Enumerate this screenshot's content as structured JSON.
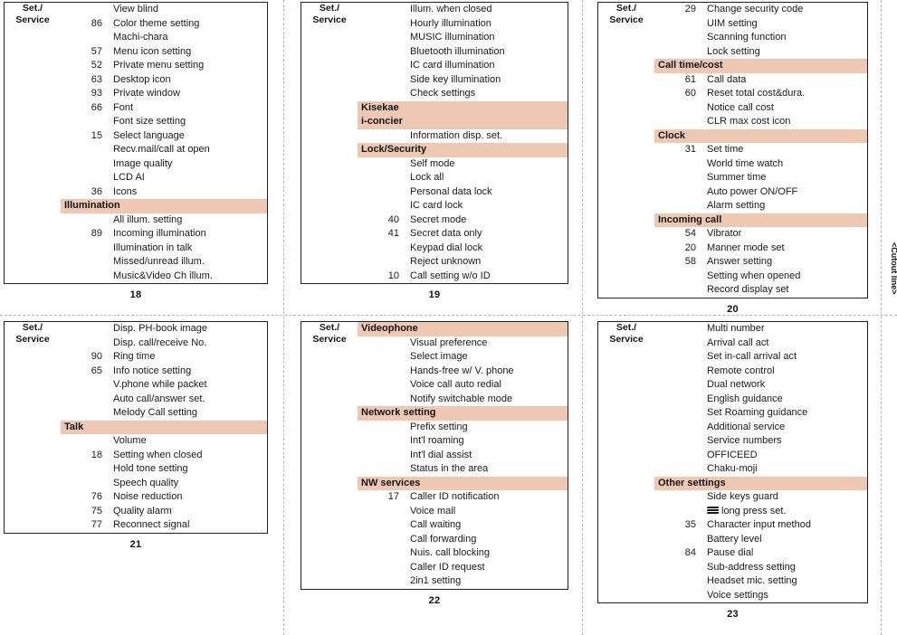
{
  "document": {
    "cutout_label": "<Cutout line>",
    "category_label_line1": "Set./",
    "category_label_line2": "Service",
    "accent_color": "#efc8b4",
    "border_color": "#231f20"
  },
  "pages": [
    {
      "number": "18",
      "category": "Set./Service",
      "rows": [
        {
          "type": "item",
          "num": "",
          "label": "View blind"
        },
        {
          "type": "item",
          "num": "86",
          "label": "Color theme setting"
        },
        {
          "type": "item",
          "num": "",
          "label": "Machi-chara"
        },
        {
          "type": "item",
          "num": "57",
          "label": "Menu icon setting"
        },
        {
          "type": "item",
          "num": "52",
          "label": "Private menu setting"
        },
        {
          "type": "item",
          "num": "63",
          "label": "Desktop icon"
        },
        {
          "type": "item",
          "num": "93",
          "label": "Private window"
        },
        {
          "type": "item",
          "num": "66",
          "label": "Font"
        },
        {
          "type": "item",
          "num": "",
          "label": "Font size setting"
        },
        {
          "type": "item",
          "num": "15",
          "label": "Select language"
        },
        {
          "type": "item",
          "num": "",
          "label": "Recv.mail/call at open"
        },
        {
          "type": "item",
          "num": "",
          "label": "Image quality"
        },
        {
          "type": "item",
          "num": "",
          "label": "LCD AI"
        },
        {
          "type": "item",
          "num": "36",
          "label": "Icons"
        },
        {
          "type": "section",
          "label": "Illumination"
        },
        {
          "type": "item",
          "num": "",
          "label": "All illum. setting"
        },
        {
          "type": "item",
          "num": "89",
          "label": "Incoming illumination"
        },
        {
          "type": "item",
          "num": "",
          "label": "Illumination in talk"
        },
        {
          "type": "item",
          "num": "",
          "label": "Missed/unread illum."
        },
        {
          "type": "item",
          "num": "",
          "label": "Music&Video Ch illum."
        }
      ]
    },
    {
      "number": "19",
      "category": "Set./Service",
      "rows": [
        {
          "type": "item",
          "num": "",
          "label": "Illum. when closed"
        },
        {
          "type": "item",
          "num": "",
          "label": "Hourly illumination"
        },
        {
          "type": "item",
          "num": "",
          "label": "MUSIC illumination"
        },
        {
          "type": "item",
          "num": "",
          "label": "Bluetooth illumination"
        },
        {
          "type": "item",
          "num": "",
          "label": "IC card illumination"
        },
        {
          "type": "item",
          "num": "",
          "label": "Side key illumination"
        },
        {
          "type": "item",
          "num": "",
          "label": "Check settings"
        },
        {
          "type": "section",
          "label": "Kisekae"
        },
        {
          "type": "section",
          "label": "i-concier"
        },
        {
          "type": "item",
          "num": "",
          "label": "Information disp. set."
        },
        {
          "type": "section",
          "label": "Lock/Security"
        },
        {
          "type": "item",
          "num": "",
          "label": "Self mode"
        },
        {
          "type": "item",
          "num": "",
          "label": "Lock all"
        },
        {
          "type": "item",
          "num": "",
          "label": "Personal data lock"
        },
        {
          "type": "item",
          "num": "",
          "label": "IC card lock"
        },
        {
          "type": "item",
          "num": "40",
          "label": "Secret mode"
        },
        {
          "type": "item",
          "num": "41",
          "label": "Secret data only"
        },
        {
          "type": "item",
          "num": "",
          "label": "Keypad dial lock"
        },
        {
          "type": "item",
          "num": "",
          "label": "Reject unknown"
        },
        {
          "type": "item",
          "num": "10",
          "label": "Call setting w/o ID"
        }
      ]
    },
    {
      "number": "20",
      "category": "Set./Service",
      "rows": [
        {
          "type": "item",
          "num": "29",
          "label": "Change security code"
        },
        {
          "type": "item",
          "num": "",
          "label": "UIM setting"
        },
        {
          "type": "item",
          "num": "",
          "label": "Scanning function"
        },
        {
          "type": "item",
          "num": "",
          "label": "Lock setting"
        },
        {
          "type": "section",
          "label": "Call time/cost"
        },
        {
          "type": "item",
          "num": "61",
          "label": "Call data"
        },
        {
          "type": "item",
          "num": "60",
          "label": "Reset total cost&dura."
        },
        {
          "type": "item",
          "num": "",
          "label": "Notice call cost"
        },
        {
          "type": "item",
          "num": "",
          "label": "CLR max cost icon"
        },
        {
          "type": "section",
          "label": "Clock"
        },
        {
          "type": "item",
          "num": "31",
          "label": "Set time"
        },
        {
          "type": "item",
          "num": "",
          "label": "World time watch"
        },
        {
          "type": "item",
          "num": "",
          "label": "Summer time"
        },
        {
          "type": "item",
          "num": "",
          "label": "Auto power ON/OFF"
        },
        {
          "type": "item",
          "num": "",
          "label": "Alarm setting"
        },
        {
          "type": "section",
          "label": "Incoming call"
        },
        {
          "type": "item",
          "num": "54",
          "label": "Vibrator"
        },
        {
          "type": "item",
          "num": "20",
          "label": "Manner mode set"
        },
        {
          "type": "item",
          "num": "58",
          "label": "Answer setting"
        },
        {
          "type": "item",
          "num": "",
          "label": "Setting when opened"
        },
        {
          "type": "item",
          "num": "",
          "label": "Record display set"
        }
      ]
    },
    {
      "number": "21",
      "category": "Set./Service",
      "rows": [
        {
          "type": "item",
          "num": "",
          "label": "Disp. PH-book image"
        },
        {
          "type": "item",
          "num": "",
          "label": "Disp. call/receive No."
        },
        {
          "type": "item",
          "num": "90",
          "label": "Ring time"
        },
        {
          "type": "item",
          "num": "65",
          "label": "Info notice setting"
        },
        {
          "type": "item",
          "num": "",
          "label": "V.phone while packet"
        },
        {
          "type": "item",
          "num": "",
          "label": "Auto call/answer set."
        },
        {
          "type": "item",
          "num": "",
          "label": "Melody Call setting"
        },
        {
          "type": "section",
          "label": "Talk"
        },
        {
          "type": "item",
          "num": "",
          "label": "Volume"
        },
        {
          "type": "item",
          "num": "18",
          "label": "Setting when closed"
        },
        {
          "type": "item",
          "num": "",
          "label": "Hold tone setting"
        },
        {
          "type": "item",
          "num": "",
          "label": "Speech quality"
        },
        {
          "type": "item",
          "num": "76",
          "label": "Noise reduction"
        },
        {
          "type": "item",
          "num": "75",
          "label": "Quality alarm"
        },
        {
          "type": "item",
          "num": "77",
          "label": "Reconnect signal"
        }
      ]
    },
    {
      "number": "22",
      "category": "Set./Service",
      "rows": [
        {
          "type": "section",
          "label": "Videophone"
        },
        {
          "type": "item",
          "num": "",
          "label": "Visual preference"
        },
        {
          "type": "item",
          "num": "",
          "label": "Select image"
        },
        {
          "type": "item",
          "num": "",
          "label": "Hands-free w/ V. phone"
        },
        {
          "type": "item",
          "num": "",
          "label": "Voice call auto redial"
        },
        {
          "type": "item",
          "num": "",
          "label": "Notify switchable mode"
        },
        {
          "type": "section",
          "label": "Network setting"
        },
        {
          "type": "item",
          "num": "",
          "label": "Prefix setting"
        },
        {
          "type": "item",
          "num": "",
          "label": "Int'l roaming"
        },
        {
          "type": "item",
          "num": "",
          "label": "Int'l dial assist"
        },
        {
          "type": "item",
          "num": "",
          "label": "Status in the area"
        },
        {
          "type": "section",
          "label": "NW services"
        },
        {
          "type": "item",
          "num": "17",
          "label": "Caller ID notification"
        },
        {
          "type": "item",
          "num": "",
          "label": "Voice mail"
        },
        {
          "type": "item",
          "num": "",
          "label": "Call waiting"
        },
        {
          "type": "item",
          "num": "",
          "label": "Call forwarding"
        },
        {
          "type": "item",
          "num": "",
          "label": "Nuis. call blocking"
        },
        {
          "type": "item",
          "num": "",
          "label": "Caller ID request"
        },
        {
          "type": "item",
          "num": "",
          "label": "2in1 setting"
        }
      ]
    },
    {
      "number": "23",
      "category": "Set./Service",
      "rows": [
        {
          "type": "item",
          "num": "",
          "label": "Multi number"
        },
        {
          "type": "item",
          "num": "",
          "label": "Arrival call act"
        },
        {
          "type": "item",
          "num": "",
          "label": "Set in-call arrival act"
        },
        {
          "type": "item",
          "num": "",
          "label": "Remote control"
        },
        {
          "type": "item",
          "num": "",
          "label": "Dual network"
        },
        {
          "type": "item",
          "num": "",
          "label": "English guidance"
        },
        {
          "type": "item",
          "num": "",
          "label": "Set Roaming guidance"
        },
        {
          "type": "item",
          "num": "",
          "label": "Additional service"
        },
        {
          "type": "item",
          "num": "",
          "label": "Service numbers"
        },
        {
          "type": "item",
          "num": "",
          "label": "OFFICEED"
        },
        {
          "type": "item",
          "num": "",
          "label": "Chaku-moji"
        },
        {
          "type": "section",
          "label": "Other settings"
        },
        {
          "type": "item",
          "num": "",
          "label": "Side keys guard"
        },
        {
          "type": "item",
          "num": "",
          "label": "long press set.",
          "icon": "stacked-key-icon"
        },
        {
          "type": "item",
          "num": "35",
          "label": "Character input method"
        },
        {
          "type": "item",
          "num": "",
          "label": "Battery level"
        },
        {
          "type": "item",
          "num": "84",
          "label": "Pause dial"
        },
        {
          "type": "item",
          "num": "",
          "label": "Sub-address setting"
        },
        {
          "type": "item",
          "num": "",
          "label": "Headset mic. setting"
        },
        {
          "type": "item",
          "num": "",
          "label": "Voice settings"
        }
      ]
    }
  ]
}
